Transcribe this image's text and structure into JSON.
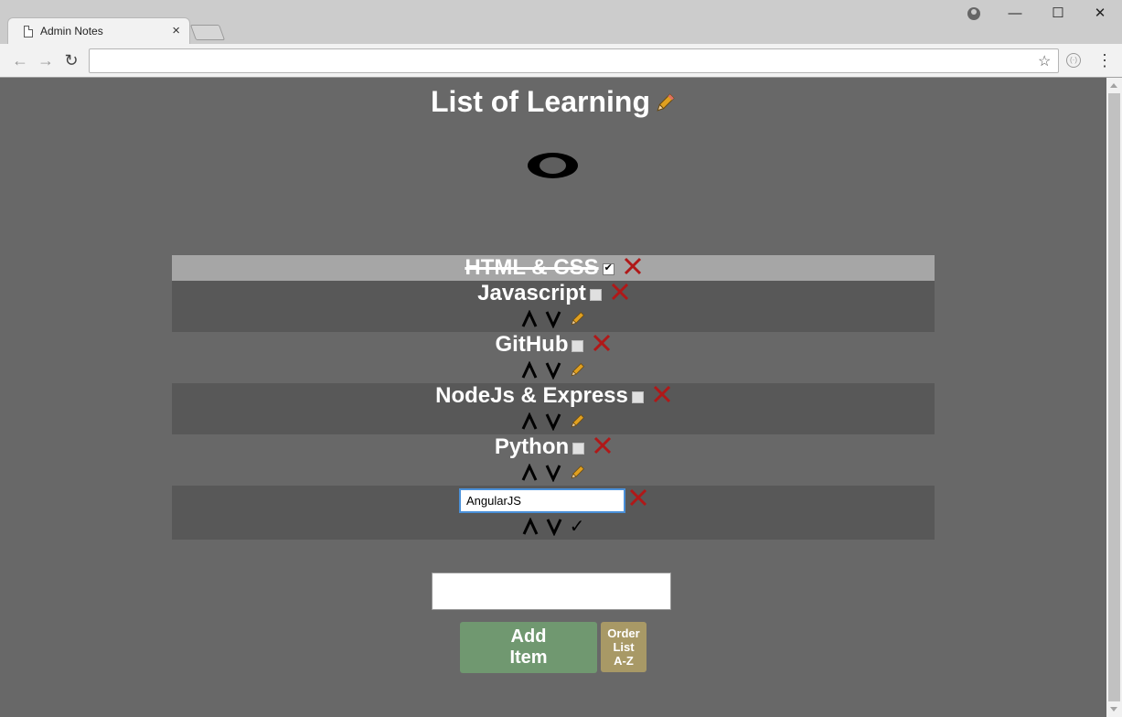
{
  "browser": {
    "tab_title": "Admin Notes",
    "tab_close": "×",
    "address": "",
    "back": "←",
    "forward": "→",
    "reload": "↻",
    "bookmark": "☆",
    "menu": "⋮",
    "extension": "(·)",
    "win_minimize": "—",
    "win_maximize": "☐",
    "win_close": "✕"
  },
  "page": {
    "title": "List of Learning",
    "items": [
      {
        "label": "HTML & CSS",
        "done": true
      },
      {
        "label": "Javascript",
        "done": false
      },
      {
        "label": "GitHub",
        "done": false
      },
      {
        "label": "NodeJs & Express",
        "done": false
      },
      {
        "label": "Python",
        "done": false
      }
    ],
    "editing_item": {
      "value": "AngularJS",
      "confirm": "✓"
    },
    "new_item_value": "",
    "add_button": "Add\nItem",
    "order_button": "Order\nList\nA-Z"
  },
  "colors": {
    "page_bg": "#686868",
    "row_dark": "#585858",
    "row_done": "#a6a6a6",
    "delete_red": "#b01818",
    "add_green": "#709870",
    "order_tan": "#a89966"
  },
  "icons": {
    "edit": "pencil-icon",
    "delete": "close-x-icon",
    "move_up": "chevron-up-icon",
    "move_down": "chevron-down-icon",
    "visibility": "eye-icon"
  }
}
